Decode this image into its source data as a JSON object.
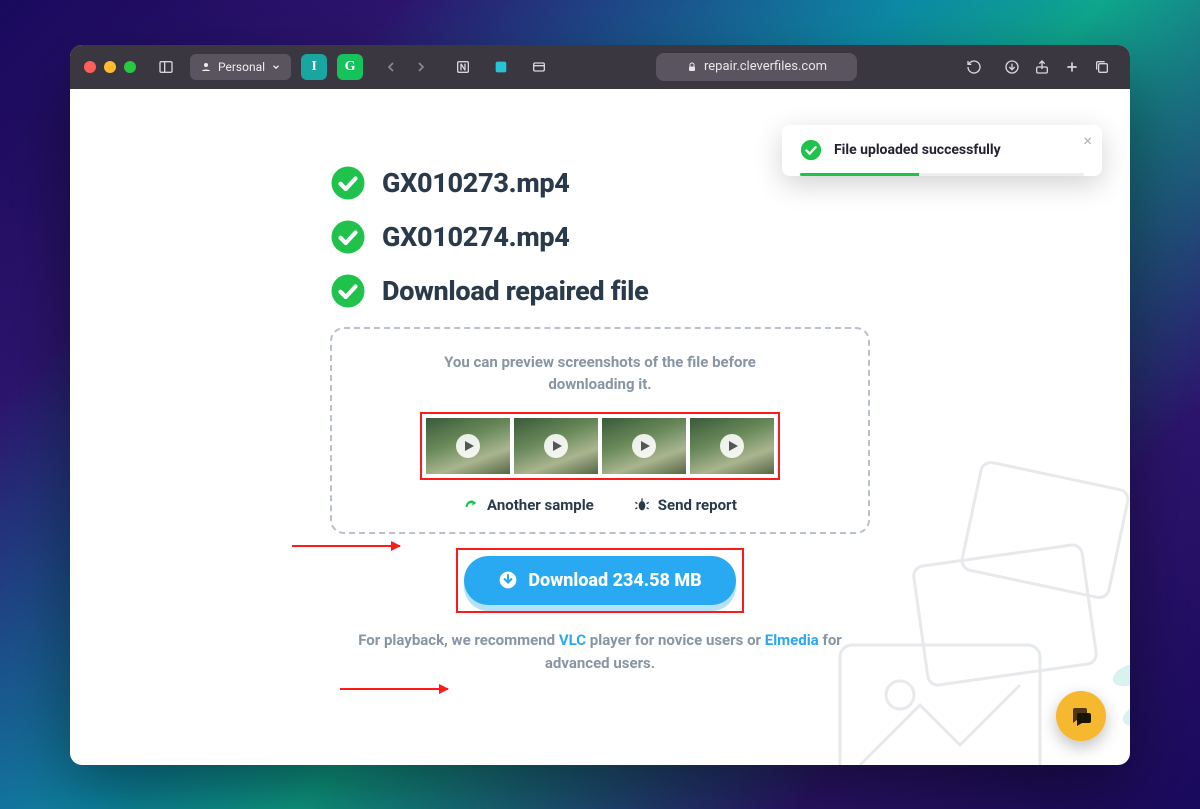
{
  "browser": {
    "profile_label": "Personal",
    "url_display": "repair.cleverfiles.com"
  },
  "toast": {
    "message": "File uploaded successfully"
  },
  "steps": {
    "file1": "GX010273.mp4",
    "file2": "GX010274.mp4",
    "download_heading": "Download repaired file"
  },
  "preview": {
    "hint": "You can preview screenshots of the file before downloading it.",
    "another_sample_label": "Another sample",
    "send_report_label": "Send report"
  },
  "download": {
    "button_label": "Download 234.58 MB"
  },
  "recommend": {
    "pre": "For playback, we recommend ",
    "vlc": "VLC",
    "mid": " player for novice users or ",
    "elmedia": "Elmedia",
    "post": " for advanced users."
  }
}
